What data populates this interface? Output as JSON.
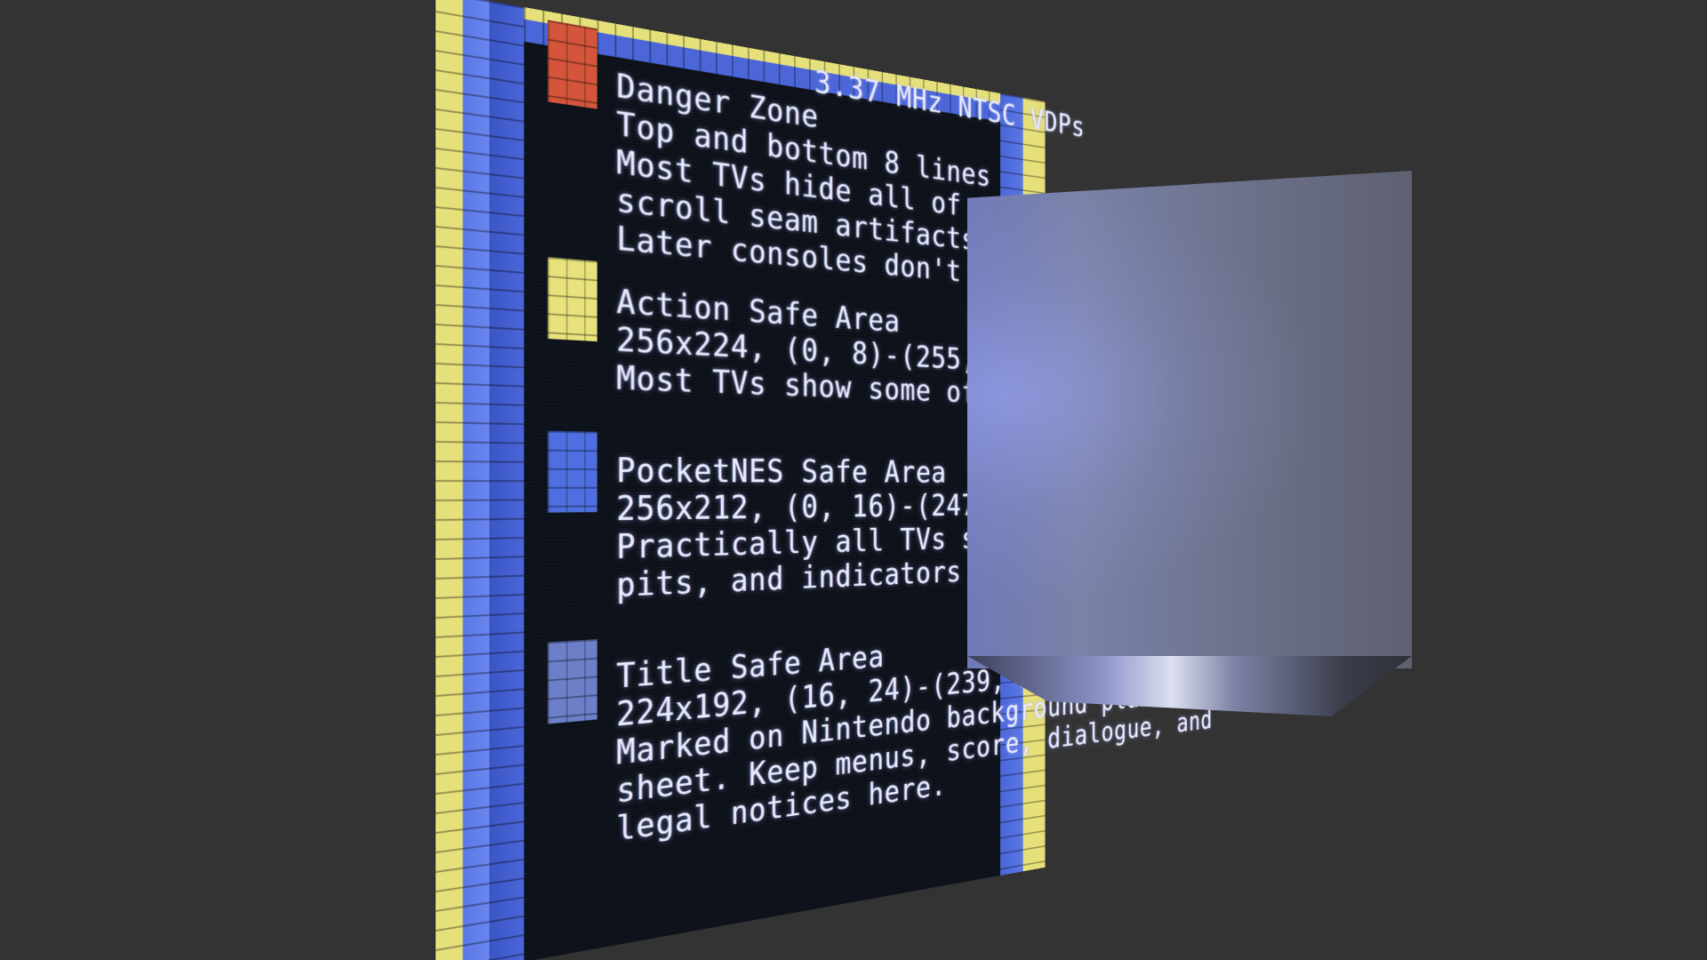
{
  "screen": {
    "header_fragment": "3.37 MHz NTSC VDPs",
    "sections": [
      {
        "swatch_color": "#d4553a",
        "lines": [
          "Danger Zone",
          "Top and bottom 8 lines",
          "Most TVs hide all of this.",
          "scroll seam artifacts here",
          "Later consoles don't even"
        ]
      },
      {
        "swatch_color": "#e8e27c",
        "lines": [
          "Action Safe Area",
          "256x224, (0, 8)-(255, 231)",
          "Most TVs show some of th"
        ]
      },
      {
        "swatch_color": "#4f6fe0",
        "lines": [
          "PocketNES Safe Area",
          "256x212, (0, 16)-(247, 227",
          "Practically all TVs show this. Platforms,",
          "pits, and indicators are fine."
        ]
      },
      {
        "swatch_color": "#6d7fc8",
        "lines": [
          "Title Safe Area",
          "224x192, (16, 24)-(239, 215)",
          "Marked on Nintendo background planning",
          "sheet. Keep menus, score, dialogue, and",
          "legal notices here."
        ]
      }
    ]
  },
  "colors": {
    "background": "#333333",
    "border_yellow": "#e6e07a",
    "border_blue": "#4a66d8",
    "screen_dark": "#0c1018",
    "text": "#e8ecff",
    "cube_face": "#6f7490"
  }
}
